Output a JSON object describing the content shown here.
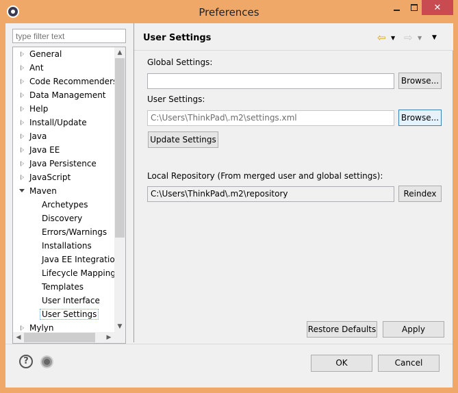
{
  "window": {
    "title": "Preferences",
    "close_glyph": "✕"
  },
  "sidebar": {
    "filter_placeholder": "type filter text",
    "items": [
      {
        "label": "General",
        "expander": "closed"
      },
      {
        "label": "Ant",
        "expander": "closed"
      },
      {
        "label": "Code Recommenders",
        "expander": "closed"
      },
      {
        "label": "Data Management",
        "expander": "closed"
      },
      {
        "label": "Help",
        "expander": "closed"
      },
      {
        "label": "Install/Update",
        "expander": "closed"
      },
      {
        "label": "Java",
        "expander": "closed"
      },
      {
        "label": "Java EE",
        "expander": "closed"
      },
      {
        "label": "Java Persistence",
        "expander": "closed"
      },
      {
        "label": "JavaScript",
        "expander": "closed"
      },
      {
        "label": "Maven",
        "expander": "open"
      },
      {
        "label": "Archetypes",
        "child": true
      },
      {
        "label": "Discovery",
        "child": true
      },
      {
        "label": "Errors/Warnings",
        "child": true
      },
      {
        "label": "Installations",
        "child": true
      },
      {
        "label": "Java EE Integration",
        "child": true
      },
      {
        "label": "Lifecycle Mapping",
        "child": true
      },
      {
        "label": "Templates",
        "child": true
      },
      {
        "label": "User Interface",
        "child": true
      },
      {
        "label": "User Settings",
        "child": true,
        "selected": true
      },
      {
        "label": "Mylyn",
        "expander": "closed"
      }
    ],
    "scroll_up": "▲",
    "scroll_down": "▼",
    "scroll_left": "◀",
    "scroll_right": "▶"
  },
  "page": {
    "title": "User Settings",
    "global_settings_label": "Global Settings:",
    "global_settings_value": "",
    "global_browse": "Browse...",
    "user_settings_label": "User Settings:",
    "user_settings_value": "C:\\Users\\ThinkPad\\.m2\\settings.xml",
    "user_browse": "Browse...",
    "update_settings": "Update Settings",
    "local_repo_label": "Local Repository (From merged user and global settings):",
    "local_repo_value": "C:\\Users\\ThinkPad\\.m2\\repository",
    "reindex": "Reindex",
    "restore_defaults": "Restore Defaults",
    "apply": "Apply",
    "nav_back_glyph": "⇦",
    "nav_forward_glyph": "⇨",
    "dropdown_glyph": "▼"
  },
  "footer": {
    "help_glyph": "?",
    "ok": "OK",
    "cancel": "Cancel"
  },
  "colors": {
    "titlebar": "#f0a868",
    "close_button": "#c74b50",
    "nav_back": "#d8a020"
  }
}
